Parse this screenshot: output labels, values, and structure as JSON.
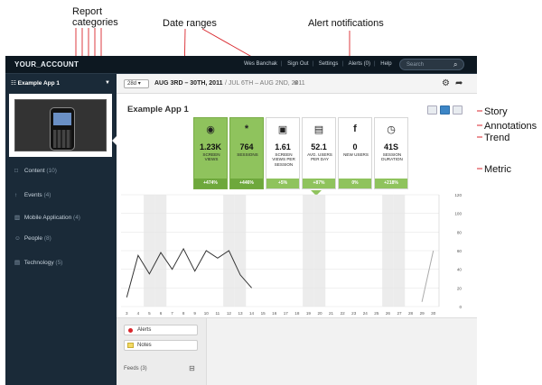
{
  "callouts": {
    "report_categories": "Report categories",
    "date_ranges": "Date ranges",
    "alert_notifications": "Alert notifications",
    "story": "Story",
    "annotations": "Annotations",
    "trend": "Trend",
    "metric": "Metric"
  },
  "topbar": {
    "account": "YOUR_ACCOUNT",
    "user": "Wes Banchak",
    "sign_out": "Sign Out",
    "settings": "Settings",
    "alerts": "Alerts (0)",
    "help": "Help",
    "search_placeholder": "Search"
  },
  "sidebar": {
    "app_selector": "Example App 1",
    "items": [
      {
        "label": "Content",
        "count": "(10)",
        "icon": "□"
      },
      {
        "label": "Events",
        "count": "(4)",
        "icon": "↑"
      },
      {
        "label": "Mobile Application",
        "count": "(4)",
        "icon": "▥"
      },
      {
        "label": "People",
        "count": "(8)",
        "icon": "☺"
      },
      {
        "label": "Technology",
        "count": "(5)",
        "icon": "▤"
      }
    ]
  },
  "datebar": {
    "range_select": "28d",
    "range_primary": "AUG 3RD – 30TH, 2011",
    "range_compare": "/ JUL 6TH – AUG 2ND, 2011"
  },
  "main": {
    "title": "Example App 1"
  },
  "metrics": [
    {
      "icon": "◉",
      "value": "1.23K",
      "label": "SCREEN VIEWS",
      "change": "+474%",
      "active": true
    },
    {
      "icon": "*",
      "value": "764",
      "label": "SESSIONS",
      "change": "+446%",
      "active": true
    },
    {
      "icon": "▣",
      "value": "1.61",
      "label": "SCREEN VIEWS PER SESSION",
      "change": "+5%",
      "active": false
    },
    {
      "icon": "▤",
      "value": "52.1",
      "label": "AVG. USERS PER DAY",
      "change": "+87%",
      "active": false
    },
    {
      "icon": "f",
      "value": "0",
      "label": "NEW USERS",
      "change": "0%",
      "active": false
    },
    {
      "icon": "◷",
      "value": "41S",
      "label": "SESSION DURATION",
      "change": "+218%",
      "active": false
    }
  ],
  "chart_data": {
    "type": "line",
    "x_ticks": [
      "3",
      "4",
      "5",
      "6",
      "7",
      "8",
      "9",
      "10",
      "11",
      "12",
      "13",
      "14",
      "15",
      "16",
      "17",
      "18",
      "19",
      "20",
      "21",
      "22",
      "23",
      "24",
      "25",
      "26",
      "27",
      "28",
      "29",
      "30"
    ],
    "y_ticks": [
      0,
      20,
      40,
      60,
      80,
      100,
      120
    ],
    "ylim": [
      0,
      120
    ],
    "series": [
      {
        "values": [
          10,
          55,
          35,
          58,
          40,
          62,
          38,
          60,
          52,
          60,
          34,
          20,
          null,
          null,
          null,
          null,
          null,
          null,
          null,
          null,
          null,
          null,
          null,
          null,
          null,
          null,
          null,
          null
        ]
      },
      {
        "values": [
          null,
          null,
          null,
          null,
          null,
          null,
          null,
          null,
          null,
          null,
          null,
          null,
          null,
          null,
          null,
          null,
          null,
          null,
          null,
          null,
          null,
          null,
          null,
          null,
          null,
          null,
          5,
          60
        ]
      }
    ]
  },
  "lower": {
    "alerts": "Alerts",
    "notes": "Notes",
    "feeds": "Feeds (3)"
  }
}
